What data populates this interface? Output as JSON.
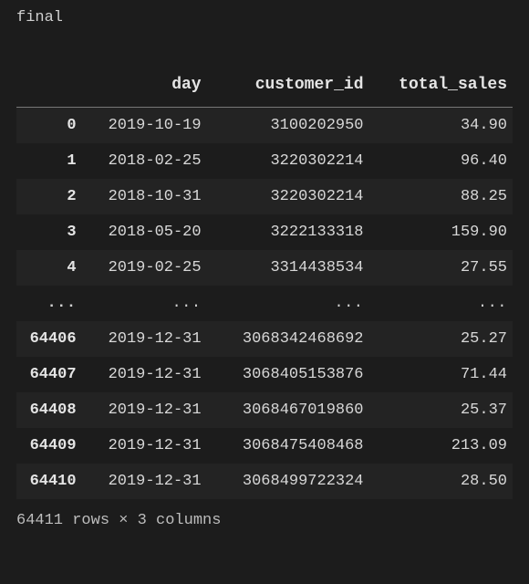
{
  "cell": {
    "label": "final"
  },
  "table": {
    "columns": [
      "day",
      "customer_id",
      "total_sales"
    ],
    "ellipsis": "...",
    "rows_head": [
      {
        "index": "0",
        "day": "2019-10-19",
        "customer_id": "3100202950",
        "total_sales": "34.90"
      },
      {
        "index": "1",
        "day": "2018-02-25",
        "customer_id": "3220302214",
        "total_sales": "96.40"
      },
      {
        "index": "2",
        "day": "2018-10-31",
        "customer_id": "3220302214",
        "total_sales": "88.25"
      },
      {
        "index": "3",
        "day": "2018-05-20",
        "customer_id": "3222133318",
        "total_sales": "159.90"
      },
      {
        "index": "4",
        "day": "2019-02-25",
        "customer_id": "3314438534",
        "total_sales": "27.55"
      }
    ],
    "rows_tail": [
      {
        "index": "64406",
        "day": "2019-12-31",
        "customer_id": "3068342468692",
        "total_sales": "25.27"
      },
      {
        "index": "64407",
        "day": "2019-12-31",
        "customer_id": "3068405153876",
        "total_sales": "71.44"
      },
      {
        "index": "64408",
        "day": "2019-12-31",
        "customer_id": "3068467019860",
        "total_sales": "25.37"
      },
      {
        "index": "64409",
        "day": "2019-12-31",
        "customer_id": "3068475408468",
        "total_sales": "213.09"
      },
      {
        "index": "64410",
        "day": "2019-12-31",
        "customer_id": "3068499722324",
        "total_sales": "28.50"
      }
    ],
    "shape_text": "64411 rows × 3 columns"
  }
}
